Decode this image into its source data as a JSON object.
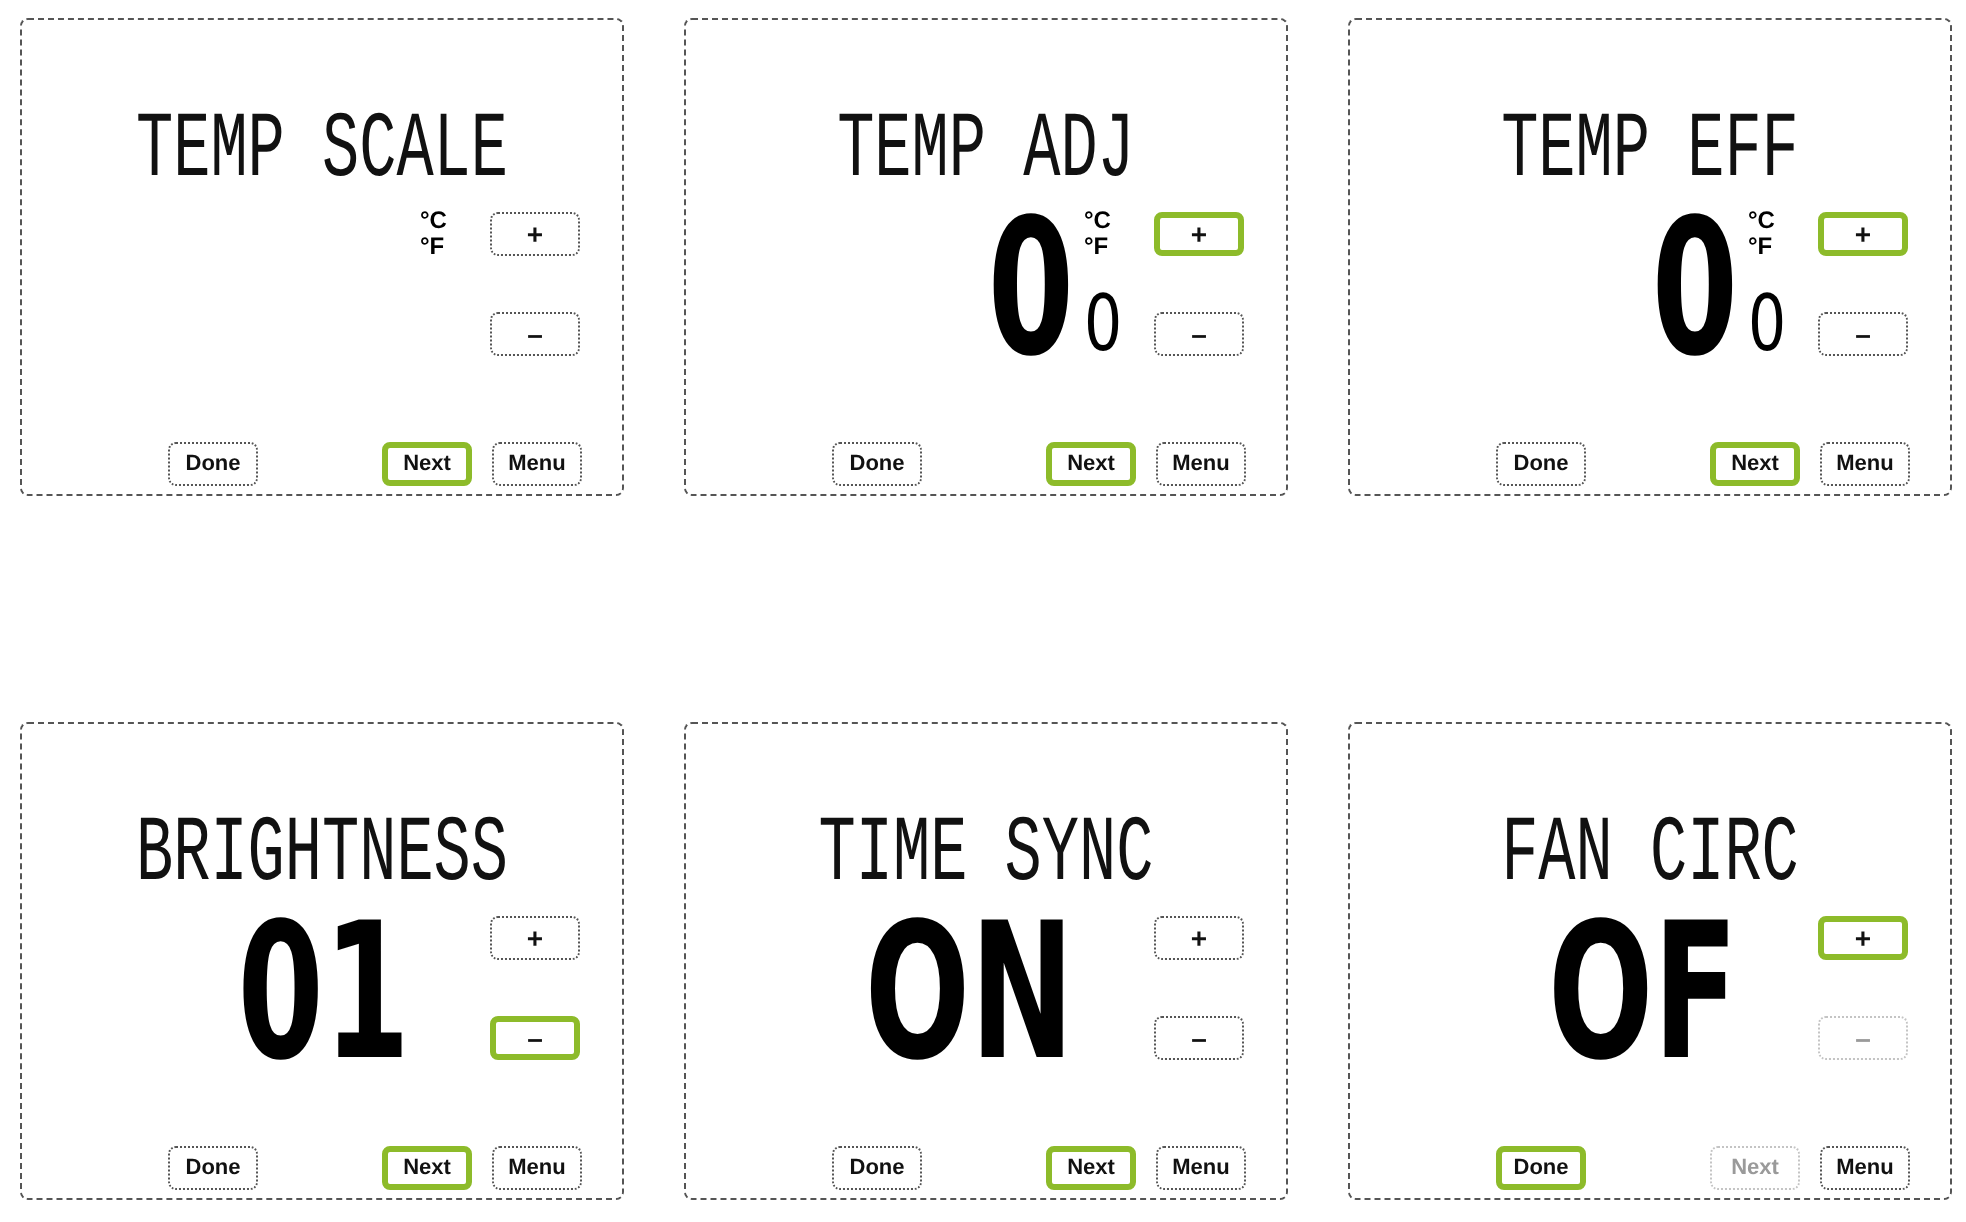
{
  "screens": [
    {
      "title": "TEMP SCALE",
      "units": [
        "°C",
        "°F"
      ],
      "adjust_buttons": [
        {
          "label": "+",
          "highlighted": false,
          "disabled": false
        },
        {
          "label": "–",
          "highlighted": false,
          "disabled": false
        }
      ],
      "actions": [
        {
          "label": "Done",
          "highlighted": false,
          "disabled": false
        },
        {
          "label": "Next",
          "highlighted": true,
          "disabled": false
        },
        {
          "label": "Menu",
          "highlighted": false,
          "disabled": false
        }
      ]
    },
    {
      "title": "TEMP ADJ",
      "value": "0",
      "units": [
        "°C",
        "°F"
      ],
      "small_digit": "0",
      "adjust_buttons": [
        {
          "label": "+",
          "highlighted": true,
          "disabled": false
        },
        {
          "label": "–",
          "highlighted": false,
          "disabled": false
        }
      ],
      "actions": [
        {
          "label": "Done",
          "highlighted": false,
          "disabled": false
        },
        {
          "label": "Next",
          "highlighted": true,
          "disabled": false
        },
        {
          "label": "Menu",
          "highlighted": false,
          "disabled": false
        }
      ]
    },
    {
      "title": "TEMP EFF",
      "value": "0",
      "units": [
        "°C",
        "°F"
      ],
      "small_digit": "0",
      "adjust_buttons": [
        {
          "label": "+",
          "highlighted": true,
          "disabled": false
        },
        {
          "label": "–",
          "highlighted": false,
          "disabled": false
        }
      ],
      "actions": [
        {
          "label": "Done",
          "highlighted": false,
          "disabled": false
        },
        {
          "label": "Next",
          "highlighted": true,
          "disabled": false
        },
        {
          "label": "Menu",
          "highlighted": false,
          "disabled": false
        }
      ]
    },
    {
      "title": "BRIGHTNESS",
      "value": "01",
      "adjust_buttons": [
        {
          "label": "+",
          "highlighted": false,
          "disabled": false
        },
        {
          "label": "–",
          "highlighted": true,
          "disabled": false
        }
      ],
      "actions": [
        {
          "label": "Done",
          "highlighted": false,
          "disabled": false
        },
        {
          "label": "Next",
          "highlighted": true,
          "disabled": false
        },
        {
          "label": "Menu",
          "highlighted": false,
          "disabled": false
        }
      ]
    },
    {
      "title": "TIME SYNC",
      "value": "ON",
      "adjust_buttons": [
        {
          "label": "+",
          "highlighted": false,
          "disabled": false
        },
        {
          "label": "–",
          "highlighted": false,
          "disabled": false
        }
      ],
      "actions": [
        {
          "label": "Done",
          "highlighted": false,
          "disabled": false
        },
        {
          "label": "Next",
          "highlighted": true,
          "disabled": false
        },
        {
          "label": "Menu",
          "highlighted": false,
          "disabled": false
        }
      ]
    },
    {
      "title": "FAN CIRC",
      "value": "OF",
      "adjust_buttons": [
        {
          "label": "+",
          "highlighted": true,
          "disabled": false
        },
        {
          "label": "–",
          "highlighted": false,
          "disabled": true
        }
      ],
      "actions": [
        {
          "label": "Done",
          "highlighted": true,
          "disabled": false
        },
        {
          "label": "Next",
          "highlighted": false,
          "disabled": true
        },
        {
          "label": "Menu",
          "highlighted": false,
          "disabled": false
        }
      ]
    }
  ]
}
